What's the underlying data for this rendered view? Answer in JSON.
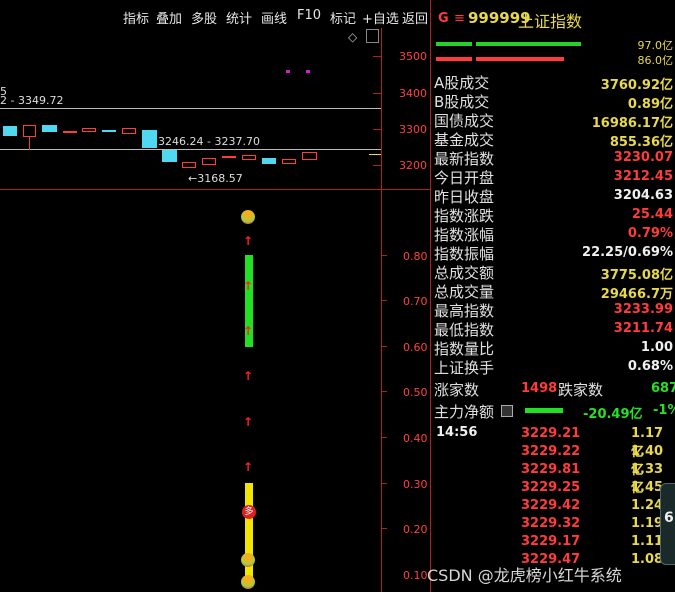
{
  "menu": [
    "指标",
    "叠加",
    "多股",
    "统计",
    "画线",
    "F10",
    "标记",
    "+自选",
    "返回"
  ],
  "header": {
    "g_label": "G",
    "code": "999999",
    "name": "上证指数"
  },
  "volume_bars": [
    {
      "value": "97.0亿",
      "color": "#2ad02a"
    },
    {
      "value": "86.0亿",
      "color": "#ff3b3b"
    }
  ],
  "stats": [
    {
      "label": "A股成交",
      "value": "3760.92亿",
      "color": "#e8d84b"
    },
    {
      "label": "B股成交",
      "value": "0.89亿",
      "color": "#e8d84b"
    },
    {
      "label": "国债成交",
      "value": "16986.17亿",
      "color": "#e8d84b"
    },
    {
      "label": "基金成交",
      "value": "855.36亿",
      "color": "#e8d84b"
    },
    {
      "label": "最新指数",
      "value": "3230.07",
      "color": "#ff3b3b"
    },
    {
      "label": "今日开盘",
      "value": "3212.45",
      "color": "#ff3b3b"
    },
    {
      "label": "昨日收盘",
      "value": "3204.63",
      "color": "#f0f0f0"
    },
    {
      "label": "指数涨跌",
      "value": "25.44",
      "color": "#ff3b3b"
    },
    {
      "label": "指数涨幅",
      "value": "0.79%",
      "color": "#ff3b3b"
    },
    {
      "label": "指数振幅",
      "value": "22.25/0.69%",
      "color": "#f0f0f0"
    },
    {
      "label": "总成交额",
      "value": "3775.08亿",
      "color": "#e8d84b"
    },
    {
      "label": "总成交量",
      "value": "29466.7万",
      "color": "#e8d84b"
    },
    {
      "label": "最高指数",
      "value": "3233.99",
      "color": "#ff3b3b"
    },
    {
      "label": "最低指数",
      "value": "3211.74",
      "color": "#ff3b3b"
    },
    {
      "label": "指数量比",
      "value": "1.00",
      "color": "#f0f0f0"
    },
    {
      "label": "上证换手",
      "value": "0.68%",
      "color": "#f0f0f0"
    }
  ],
  "breadth": {
    "up_label": "涨家数",
    "up_value": "1498",
    "down_label": "跌家数",
    "down_value": "687"
  },
  "main_force": {
    "label": "主力净额",
    "value": "-20.49亿",
    "pct": "-1%"
  },
  "time": "14:56",
  "ticks": [
    {
      "price": "3229.21",
      "vol": "1.17亿"
    },
    {
      "price": "3229.22",
      "vol": "1.40亿"
    },
    {
      "price": "3229.81",
      "vol": "1.33亿"
    },
    {
      "price": "3229.25",
      "vol": "1.45"
    },
    {
      "price": "3229.42",
      "vol": "1.24"
    },
    {
      "price": "3229.32",
      "vol": "1.19"
    },
    {
      "price": "3229.17",
      "vol": "1.11"
    },
    {
      "price": "3229.47",
      "vol": "1.08"
    }
  ],
  "chart_annotations": {
    "range_left": "2 - 3349.72",
    "left_edge_digit": "5",
    "range_mid": "3246.24 - 3237.70",
    "low_mark": "←3168.57",
    "duo_badge": "多"
  },
  "price_axis": [
    "3500",
    "3400",
    "3300",
    "3200"
  ],
  "pct_axis": [
    "0.80",
    "0.70",
    "0.60",
    "0.50",
    "0.40",
    "0.30",
    "0.20",
    "0.10"
  ],
  "watermark": "CSDN @龙虎榜小红牛系统",
  "side_widget_digit": "6"
}
